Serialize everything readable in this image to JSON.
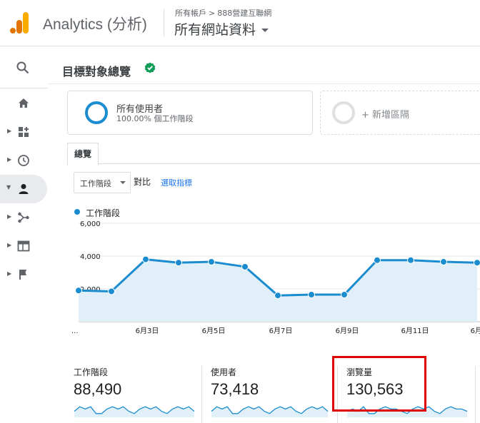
{
  "header": {
    "product_name": "Analytics (分析)",
    "breadcrumb": [
      "所有帳戶",
      "888營建互聯網"
    ],
    "view_name": "所有網站資料"
  },
  "sidebar": {
    "items": [
      {
        "name": "search",
        "icon": "search-icon"
      },
      {
        "name": "home",
        "icon": "home-icon"
      },
      {
        "name": "customization",
        "icon": "dashboard-icon"
      },
      {
        "name": "realtime",
        "icon": "clock-icon"
      },
      {
        "name": "audience",
        "icon": "person-icon",
        "active": true
      },
      {
        "name": "acquisition",
        "icon": "acquisition-icon"
      },
      {
        "name": "behavior",
        "icon": "behavior-icon"
      },
      {
        "name": "conversions",
        "icon": "flag-icon"
      }
    ]
  },
  "page": {
    "title": "目標對象總覽",
    "verified_icon": "verified-check-icon"
  },
  "segments": {
    "active": {
      "name": "所有使用者",
      "sub": "100.00% 個工作階段"
    },
    "add_label": "+ 新增區隔"
  },
  "tabs": [
    "總覽"
  ],
  "controls": {
    "metric": "工作階段",
    "vs": "對比",
    "select_metric": "選取指標"
  },
  "legend": {
    "label": "工作階段"
  },
  "chart_data": {
    "type": "line",
    "y_ticks": [
      "6,000",
      "4,000",
      "2,000"
    ],
    "x_ticks": [
      "...",
      "6月3日",
      "6月5日",
      "6月7日",
      "6月9日",
      "6月11日",
      "6月1"
    ],
    "ylim": [
      0,
      6000
    ],
    "series": [
      {
        "values": [
          1900,
          1850,
          3800,
          3600,
          3650,
          3350,
          1600,
          1650,
          1650,
          3750,
          3750,
          3650,
          3600
        ]
      }
    ],
    "color": "#1a8ccf",
    "fill": "#e1f0f8"
  },
  "scorecards": [
    {
      "name": "工作階段",
      "value": "88,490",
      "spark": [
        4,
        6,
        5,
        6,
        3,
        3,
        5,
        6,
        5,
        6,
        4,
        3,
        5,
        6,
        5,
        6,
        4,
        3,
        5,
        6,
        5,
        6,
        4
      ]
    },
    {
      "name": "使用者",
      "value": "73,418",
      "spark": [
        4,
        6,
        5,
        6,
        3,
        3,
        5,
        6,
        5,
        6,
        4,
        3,
        5,
        6,
        5,
        6,
        4,
        3,
        5,
        6,
        5,
        6,
        4
      ]
    },
    {
      "name": "瀏覽量",
      "value": "130,563",
      "spark": [
        4,
        5,
        4,
        6,
        3,
        3,
        5,
        6,
        5,
        5,
        4,
        3,
        5,
        6,
        5,
        6,
        4,
        3,
        5,
        6,
        5,
        5,
        4
      ]
    }
  ],
  "colors": {
    "accent": "#1a8ccf",
    "highlight": "#e00000",
    "verified": "#0f9d58"
  }
}
